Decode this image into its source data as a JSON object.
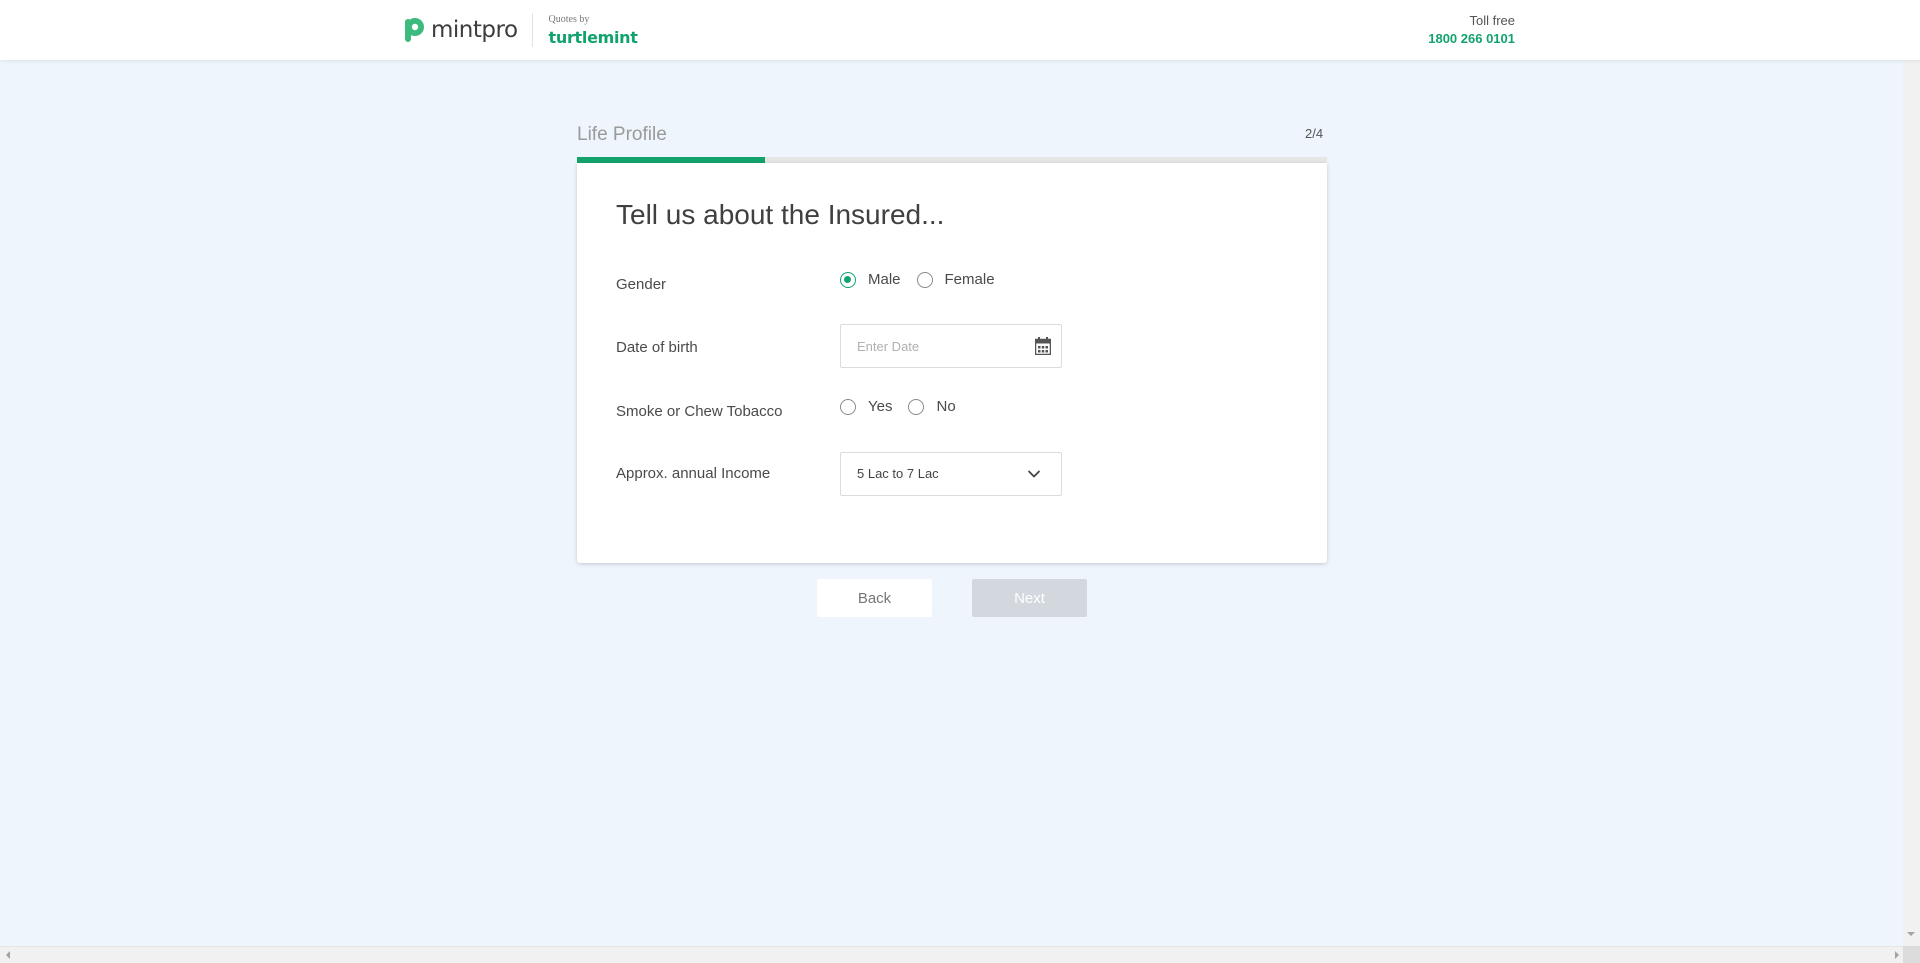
{
  "header": {
    "brand_name": "mintpro",
    "quotes_by_label": "Quotes by",
    "partner_name": "turtlemint",
    "tollfree_label": "Toll free",
    "tollfree_number": "1800 266 0101"
  },
  "step": {
    "title": "Life Profile",
    "count": "2/4",
    "progress": 0.25
  },
  "form": {
    "title": "Tell us about the Insured...",
    "gender": {
      "label": "Gender",
      "options": [
        "Male",
        "Female"
      ],
      "selected": "Male"
    },
    "dob": {
      "label": "Date of birth",
      "placeholder": "Enter Date",
      "value": ""
    },
    "tobacco": {
      "label": "Smoke or Chew Tobacco",
      "options": [
        "Yes",
        "No"
      ],
      "selected": ""
    },
    "income": {
      "label": "Approx. annual Income",
      "value": "5 Lac to 7 Lac"
    }
  },
  "buttons": {
    "back": "Back",
    "next": "Next"
  },
  "icons": {
    "calendar": "calendar-icon",
    "chevron": "chevron-down-icon",
    "logo": "mintpro-logo-icon"
  },
  "colors": {
    "accent": "#12a36d",
    "background": "#eef5fc",
    "next_disabled": "#d3d8de"
  }
}
